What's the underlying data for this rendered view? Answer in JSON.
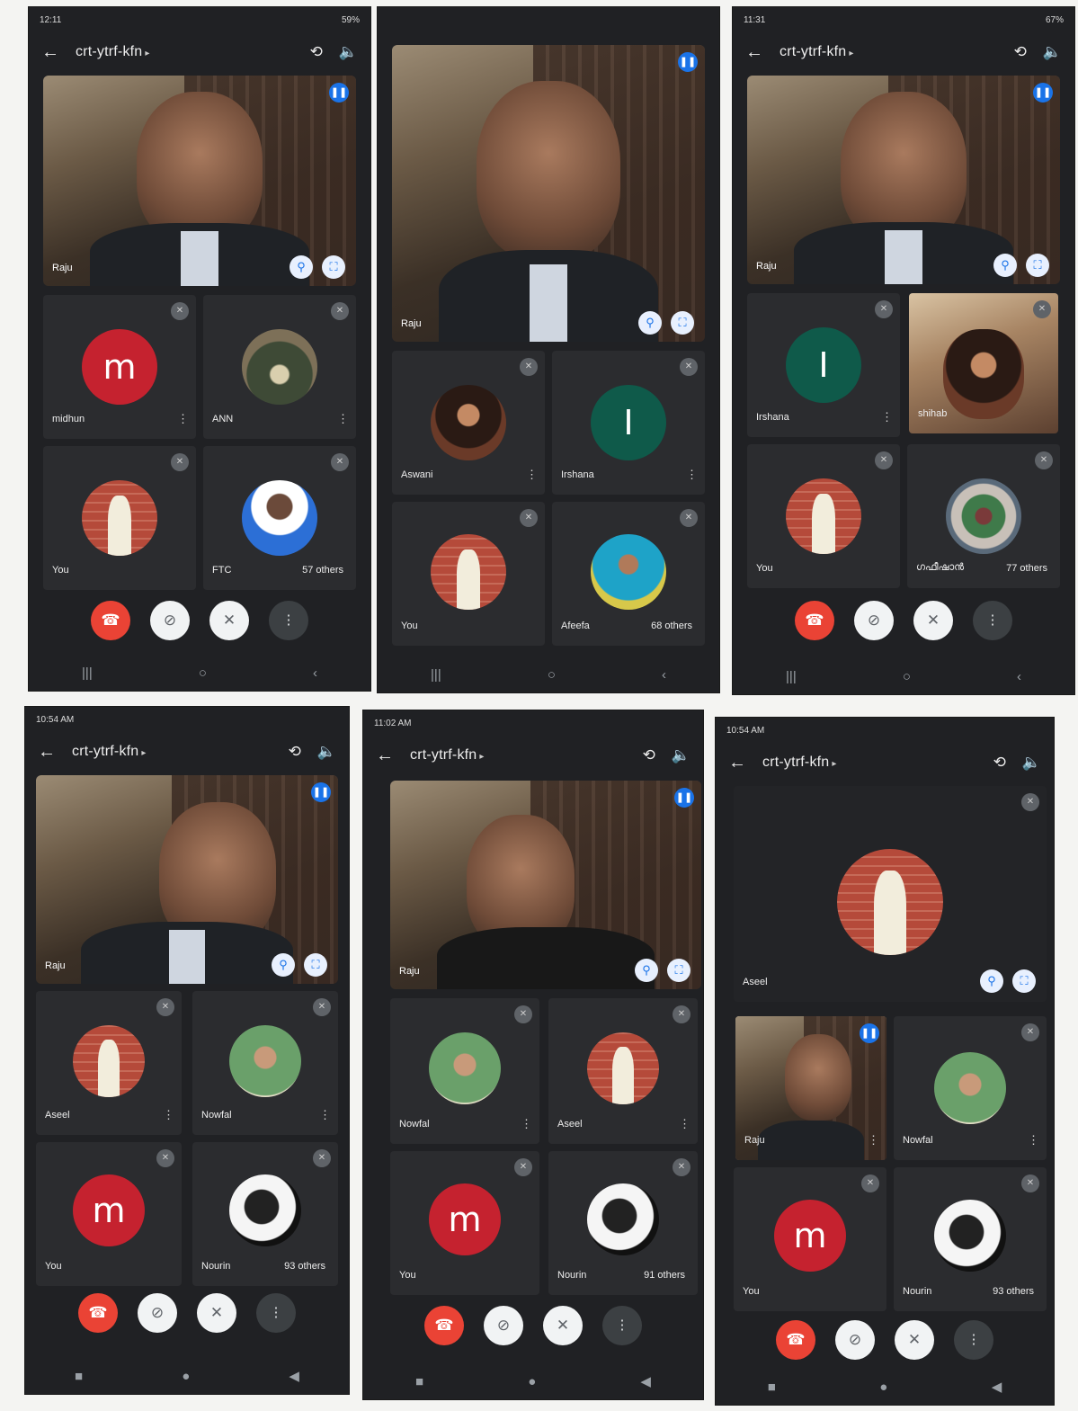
{
  "screens": [
    {
      "status_time": "12:11",
      "status_battery": "59%",
      "meeting_code": "crt-ytrf-kfn",
      "main_speaker": "Raju",
      "tiles": [
        {
          "name": "midhun",
          "avatar": "m",
          "style": "red"
        },
        {
          "name": "ANN",
          "avatar": "",
          "style": "nature"
        },
        {
          "name": "You",
          "avatar": "",
          "style": "brick"
        },
        {
          "name": "FTC",
          "avatar": "",
          "style": "blue",
          "others": "57 others"
        }
      ]
    },
    {
      "status_time": "",
      "status_battery": "",
      "meeting_code": "",
      "main_speaker": "Raju",
      "tiles": [
        {
          "name": "Aswani",
          "avatar": "",
          "style": "woman"
        },
        {
          "name": "Irshana",
          "avatar": "I",
          "style": "green"
        },
        {
          "name": "You",
          "avatar": "",
          "style": "brick"
        },
        {
          "name": "Afeefa",
          "avatar": "",
          "style": "hijab",
          "others": "68 others"
        }
      ]
    },
    {
      "status_time": "11:31",
      "status_battery": "67%",
      "meeting_code": "crt-ytrf-kfn",
      "main_speaker": "Raju",
      "tiles": [
        {
          "name": "Irshana",
          "avatar": "I",
          "style": "green"
        },
        {
          "name": "shihab",
          "avatar": "",
          "style": "video"
        },
        {
          "name": "You",
          "avatar": "",
          "style": "brick"
        },
        {
          "name": "ഗഫീഷാൻ",
          "avatar": "",
          "style": "mix",
          "others": "77 others"
        }
      ]
    },
    {
      "status_time": "10:54 AM",
      "status_battery": "",
      "meeting_code": "crt-ytrf-kfn",
      "main_speaker": "Raju",
      "tiles": [
        {
          "name": "Aseel",
          "avatar": "",
          "style": "brick"
        },
        {
          "name": "Nowfal",
          "avatar": "",
          "style": "greenphoto"
        },
        {
          "name": "You",
          "avatar": "m",
          "style": "red"
        },
        {
          "name": "Nourin",
          "avatar": "",
          "style": "bw",
          "others": "93 others"
        }
      ]
    },
    {
      "status_time": "11:02 AM",
      "status_battery": "",
      "meeting_code": "crt-ytrf-kfn",
      "main_speaker": "Raju",
      "tiles": [
        {
          "name": "Nowfal",
          "avatar": "",
          "style": "greenphoto"
        },
        {
          "name": "Aseel",
          "avatar": "",
          "style": "brick"
        },
        {
          "name": "You",
          "avatar": "m",
          "style": "red"
        },
        {
          "name": "Nourin",
          "avatar": "",
          "style": "bw",
          "others": "91 others"
        }
      ]
    },
    {
      "status_time": "10:54 AM",
      "status_battery": "",
      "meeting_code": "crt-ytrf-kfn",
      "main_speaker": "Aseel",
      "tiles": [
        {
          "name": "Raju",
          "avatar": "",
          "style": "video"
        },
        {
          "name": "Nowfal",
          "avatar": "",
          "style": "greenphoto"
        },
        {
          "name": "You",
          "avatar": "m",
          "style": "red"
        },
        {
          "name": "Nourin",
          "avatar": "",
          "style": "bw",
          "others": "93 others"
        }
      ]
    }
  ],
  "icons": {
    "back": "←",
    "switch_camera": "⟲",
    "speaker": "🔈",
    "pin": "⚲",
    "fullscreen": "⛶",
    "mic_off": "✕",
    "end_call": "☎",
    "camera_off": "⊘",
    "mic_muted": "✕",
    "more": "⋮",
    "more_tile": "⋮",
    "nav_recents": "|||",
    "nav_home": "○",
    "nav_back": "‹"
  },
  "colors": {
    "end_call": "#ea4335",
    "speaking": "#1a73e8",
    "avatar_red": "#c5222f",
    "avatar_green": "#0f5a4a"
  }
}
